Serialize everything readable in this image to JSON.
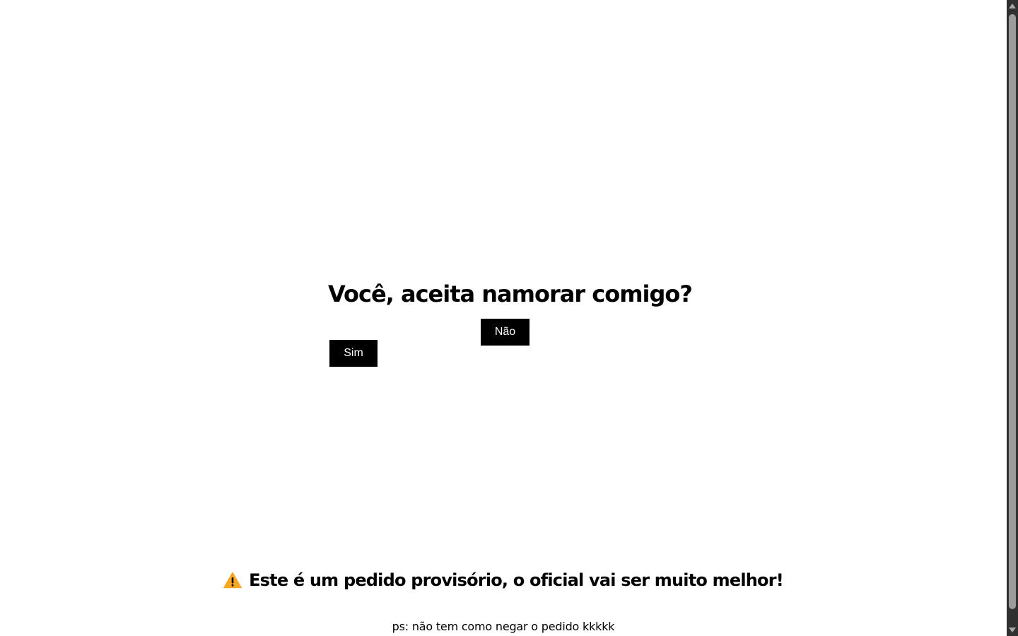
{
  "question": "Você, aceita namorar comigo?",
  "buttons": {
    "no_label": "Não",
    "yes_label": "Sim"
  },
  "notice": {
    "icon": "warning-icon",
    "text": "Este é um pedido provisório, o oficial vai ser muito melhor!"
  },
  "footnote": "ps: não tem como negar o pedido kkkkk",
  "colors": {
    "background": "#ffffff",
    "button_bg": "#000000",
    "button_text": "#ffffff",
    "warning_icon": "#f5a623",
    "scrollbar_track": "#303030"
  }
}
